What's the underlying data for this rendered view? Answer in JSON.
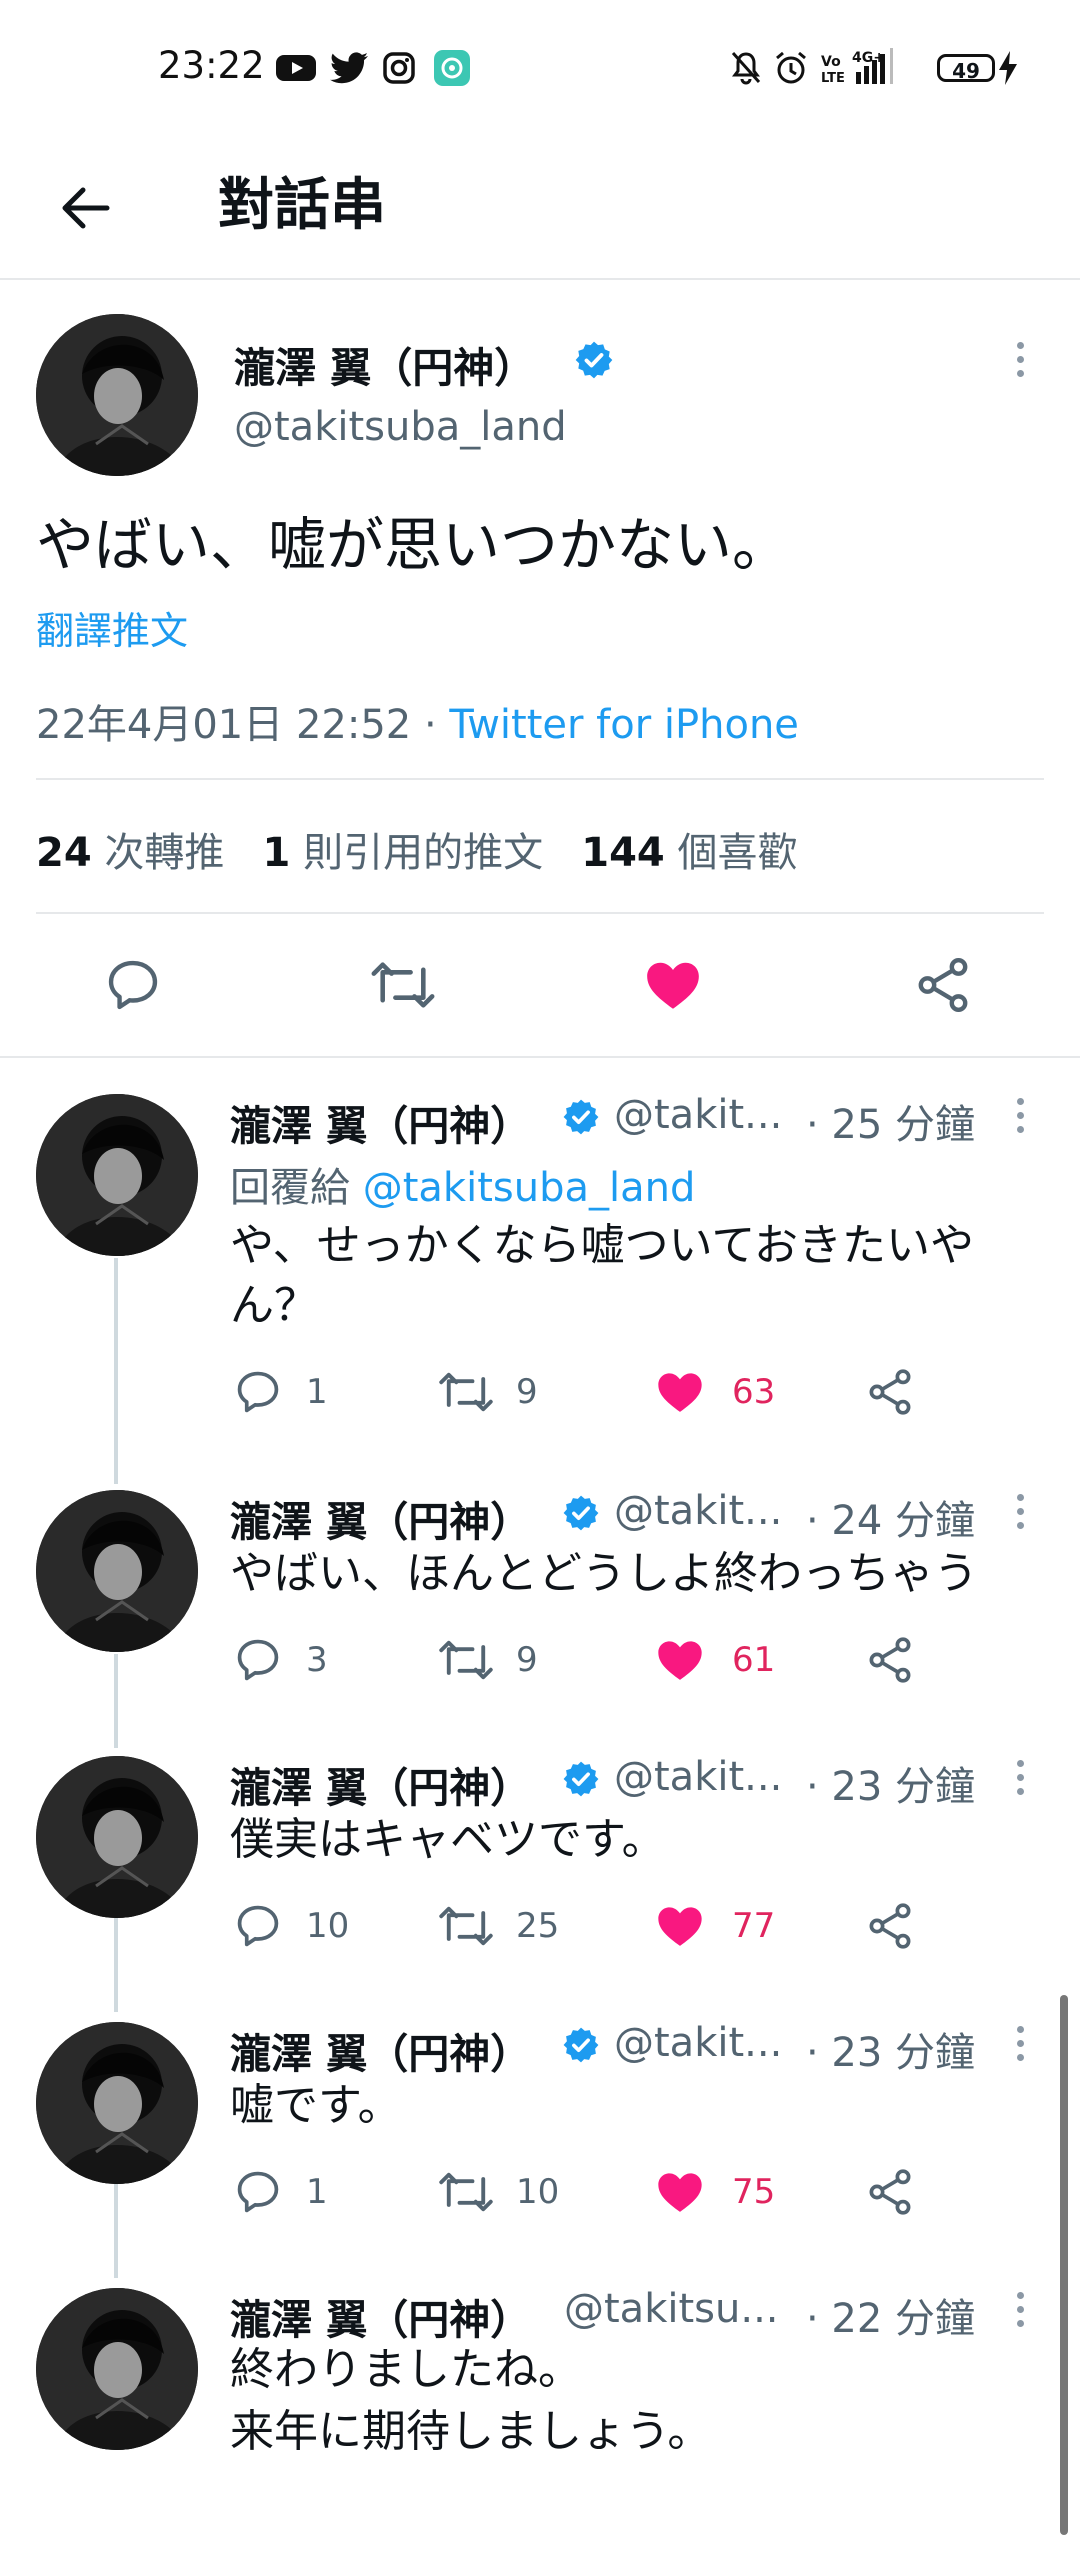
{
  "status_bar": {
    "time": "23:22",
    "battery": "49",
    "network": "4G+",
    "left_icons": [
      "youtube-icon",
      "twitter-icon",
      "instagram-icon",
      "app-notification-icon"
    ],
    "right_icons": [
      "mute-icon",
      "alarm-icon",
      "volte-icon",
      "signal-icon",
      "battery-icon",
      "charging-icon"
    ]
  },
  "header": {
    "title": "對話串",
    "back_icon": "arrow-left-icon"
  },
  "main_tweet": {
    "name": "瀧澤 翼（円神）",
    "handle": "@takitsuba_land",
    "text": "やばい、嘘が思いつかない。",
    "translate": "翻譯推文",
    "datetime": "22年4月01日 22:52 · ",
    "source": "Twitter for iPhone",
    "retweets_count": "24",
    "retweets_label": "次轉推",
    "quotes_count": "1",
    "quotes_label": "則引用的推文",
    "likes_count": "144",
    "likes_label": "個喜歡",
    "like_color": "#f91880"
  },
  "replies": [
    {
      "name": "瀧澤 翼（円神）",
      "handle": "@takit...",
      "time": "· 25 分鐘",
      "reply_prefix": "回覆給 ",
      "reply_to": "@takitsuba_land",
      "text": "や、せっかくなら嘘ついておきたいやん？",
      "replies": "1",
      "retweets": "9",
      "likes": "63",
      "verified": true
    },
    {
      "name": "瀧澤 翼（円神）",
      "handle": "@takit...",
      "time": "· 24 分鐘",
      "text": "やばい、ほんとどうしよ終わっちゃう",
      "replies": "3",
      "retweets": "9",
      "likes": "61",
      "verified": true
    },
    {
      "name": "瀧澤 翼（円神）",
      "handle": "@takit...",
      "time": "· 23 分鐘",
      "text": "僕実はキャベツです。",
      "replies": "10",
      "retweets": "25",
      "likes": "77",
      "verified": true
    },
    {
      "name": "瀧澤 翼（円神）",
      "handle": "@takit...",
      "time": "· 23 分鐘",
      "text": "嘘です。",
      "replies": "1",
      "retweets": "10",
      "likes": "75",
      "verified": true
    },
    {
      "name": "瀧澤 翼（円神）",
      "handle": "@takitsu...",
      "time": "· 22 分鐘",
      "text_line1": "終わりましたね。",
      "text_line2": "来年に期待しましょう。",
      "verified": false
    }
  ]
}
